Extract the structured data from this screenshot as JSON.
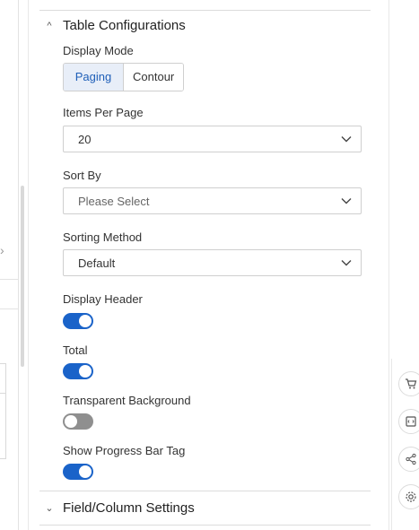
{
  "section": {
    "title": "Table Configurations",
    "collapsed_title": "Field/Column Settings"
  },
  "display_mode": {
    "label": "Display Mode",
    "options": [
      "Paging",
      "Contour"
    ],
    "selected": "Paging"
  },
  "items_per_page": {
    "label": "Items Per Page",
    "value": "20"
  },
  "sort_by": {
    "label": "Sort By",
    "placeholder": "Please Select"
  },
  "sorting_method": {
    "label": "Sorting Method",
    "value": "Default"
  },
  "toggles": [
    {
      "label": "Display Header",
      "on": true
    },
    {
      "label": "Total",
      "on": true
    },
    {
      "label": "Transparent Background",
      "on": false
    },
    {
      "label": "Show Progress Bar Tag",
      "on": true
    }
  ],
  "rail_icons": [
    "cart-icon",
    "code-icon",
    "share-icon",
    "gear-icon"
  ],
  "colors": {
    "accent": "#1a63c9",
    "toggle_off": "#8f8f8f",
    "seg_active_bg": "#e8eef8"
  }
}
